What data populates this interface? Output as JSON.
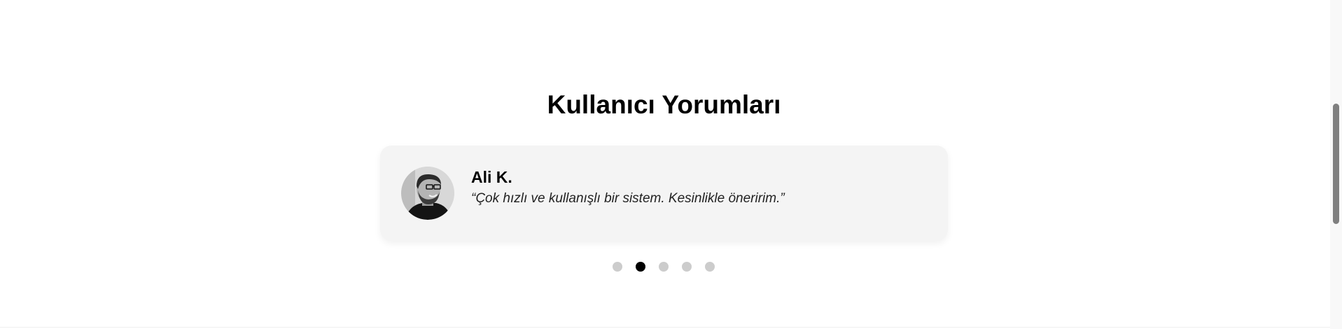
{
  "testimonials": {
    "title": "Kullanıcı Yorumları",
    "current": {
      "author": "Ali K.",
      "quote": "“Çok hızlı ve kullanışlı bir sistem. Kesinlikle öneririm.”",
      "avatar_icon": "person-photo-icon"
    },
    "pagination": {
      "total": 5,
      "active_index": 1
    }
  },
  "colors": {
    "card_background": "#f4f4f4",
    "dot_active": "#000000",
    "dot_inactive": "#cccccc"
  }
}
